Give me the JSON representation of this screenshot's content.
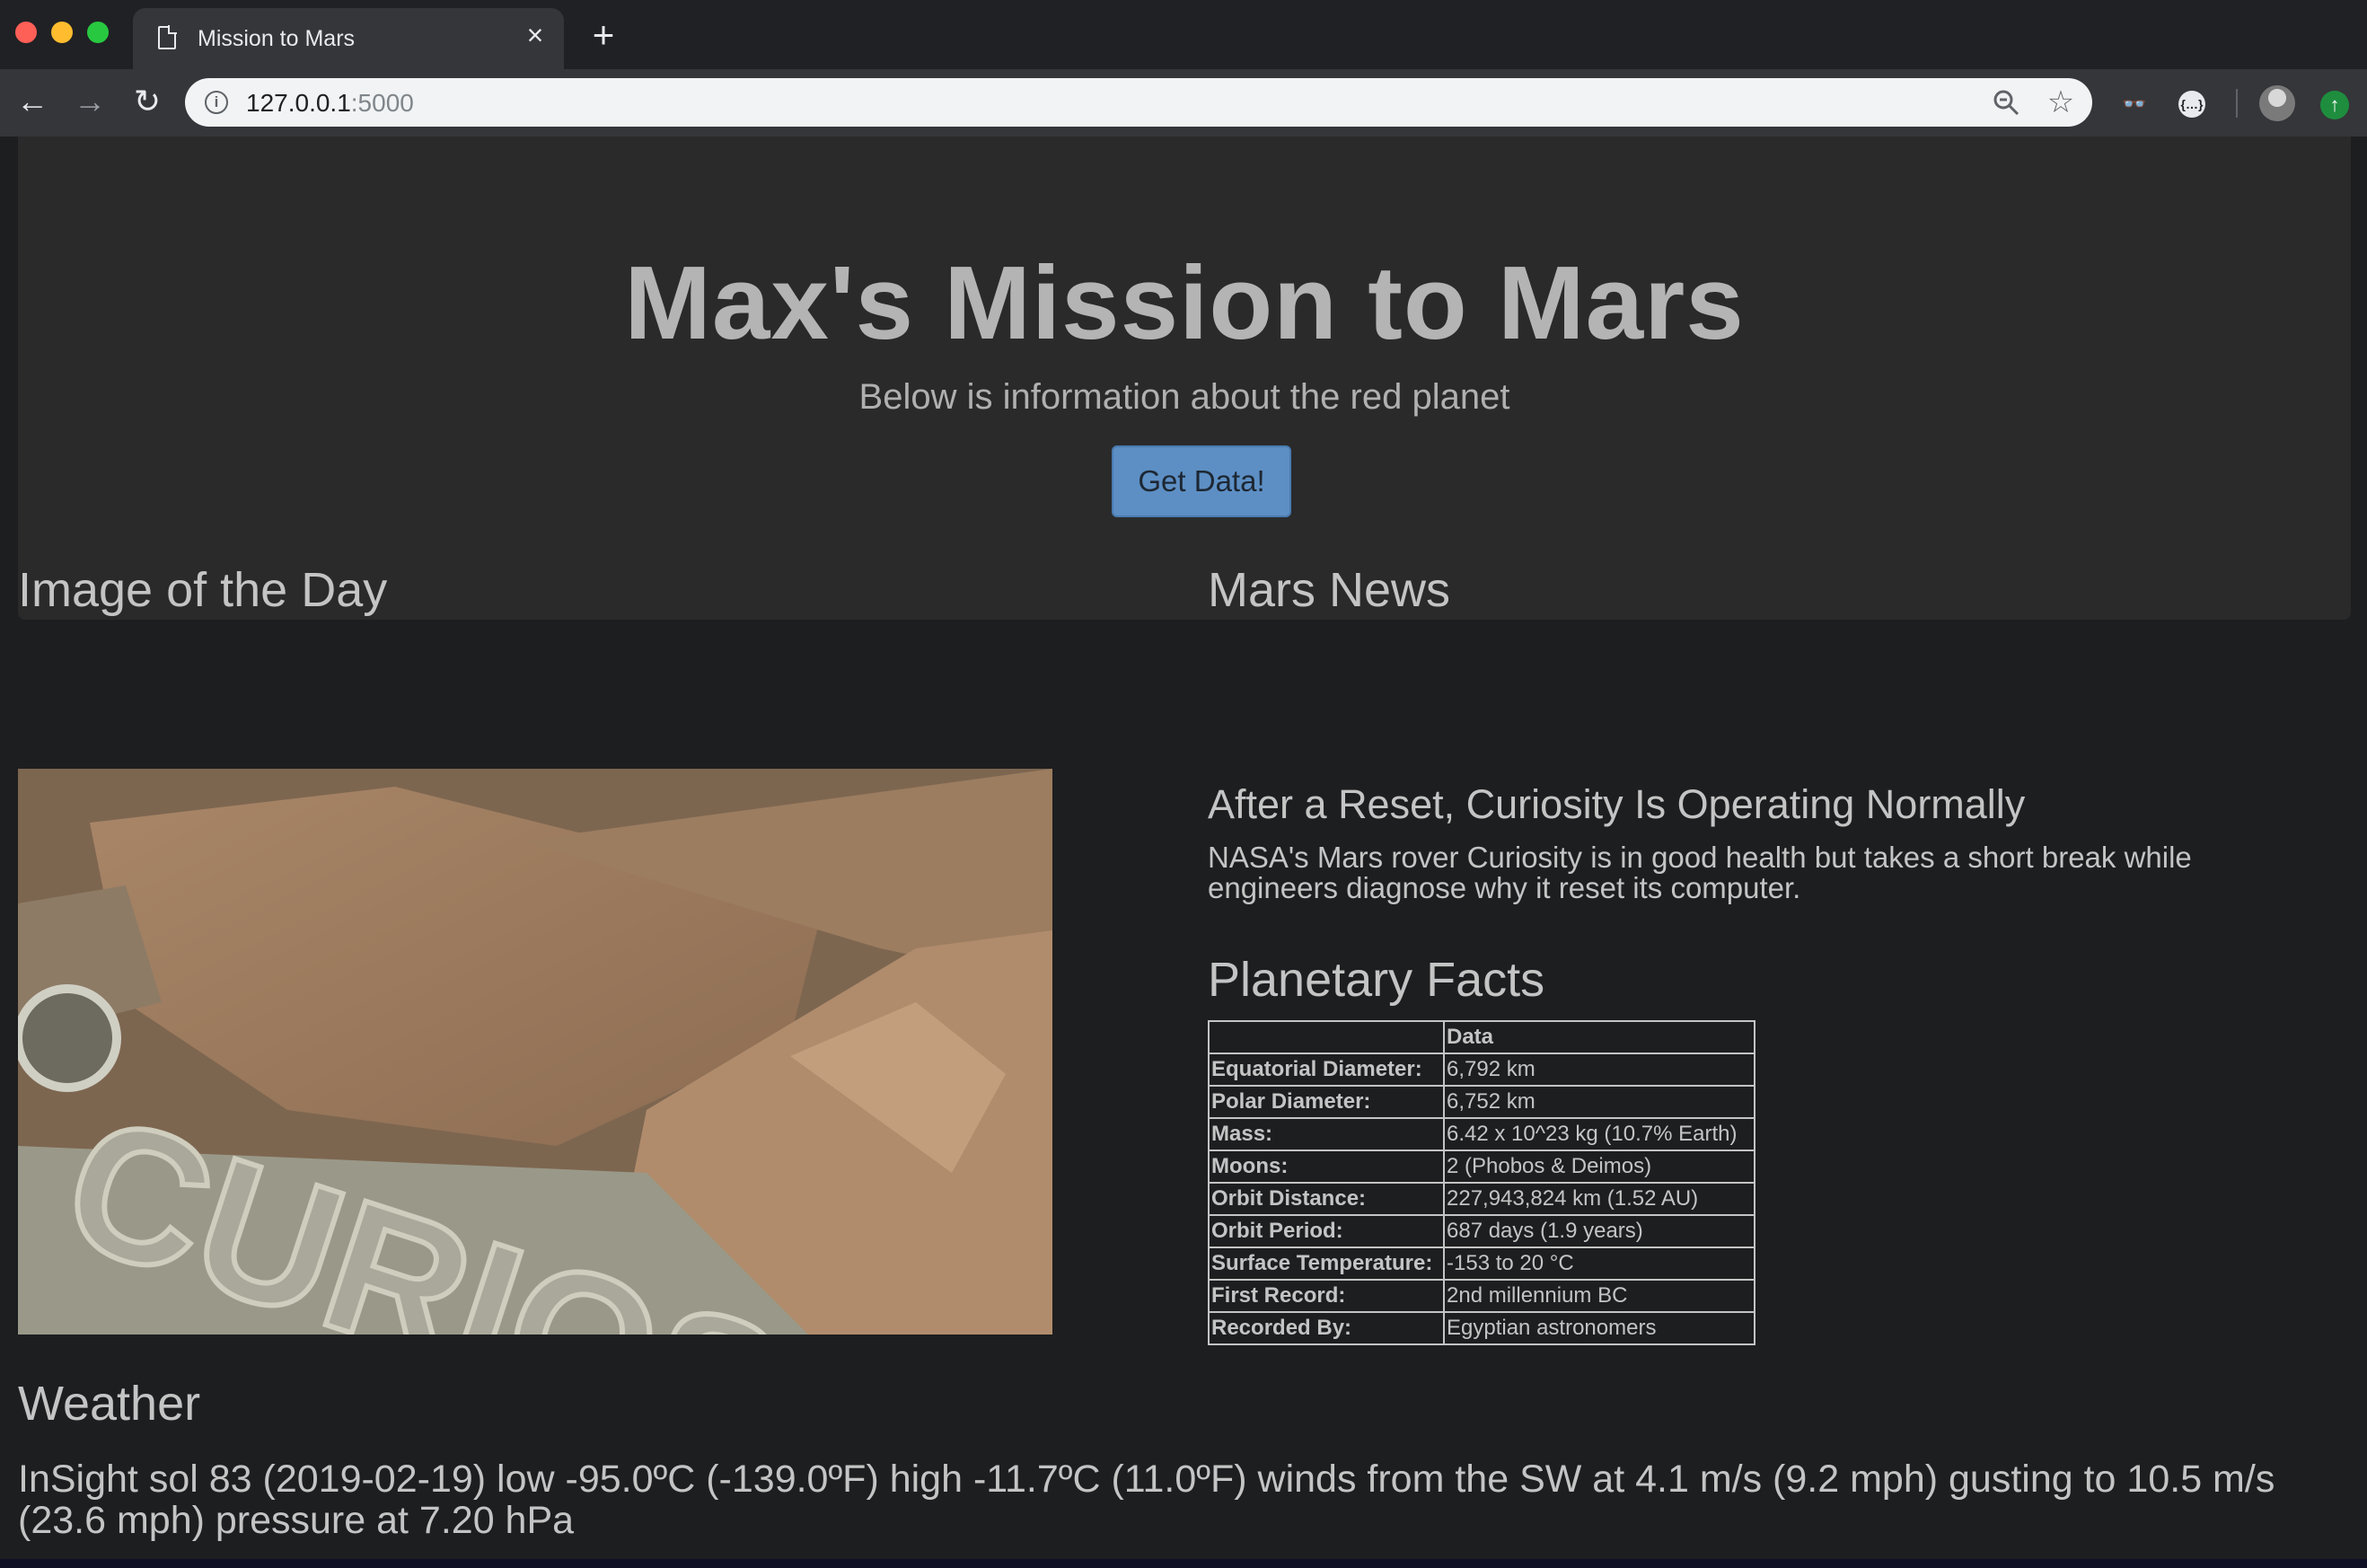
{
  "browser": {
    "tab_title": "Mission to Mars",
    "url_host": "127.0.0.1",
    "url_port": ":5000"
  },
  "jumbotron": {
    "title": "Max's Mission to Mars",
    "subtitle": "Below is information about the red planet",
    "button_label": "Get Data!"
  },
  "image_section": {
    "heading": "Image of the Day",
    "image_text": "CURIOS"
  },
  "news": {
    "heading": "Mars News",
    "title": "After a Reset, Curiosity Is Operating Normally",
    "body": "NASA's Mars rover Curiosity is in good health but takes a short break while engineers diagnose why it reset its computer."
  },
  "facts": {
    "heading": "Planetary Facts",
    "column_header": "Data",
    "rows": [
      {
        "label": "Equatorial Diameter:",
        "value": "6,792 km"
      },
      {
        "label": "Polar Diameter:",
        "value": "6,752 km"
      },
      {
        "label": "Mass:",
        "value": "6.42 x 10^23 kg (10.7% Earth)"
      },
      {
        "label": "Moons:",
        "value": "2 (Phobos & Deimos)"
      },
      {
        "label": "Orbit Distance:",
        "value": "227,943,824 km (1.52 AU)"
      },
      {
        "label": "Orbit Period:",
        "value": "687 days (1.9 years)"
      },
      {
        "label": "Surface Temperature:",
        "value": "-153 to 20 °C"
      },
      {
        "label": "First Record:",
        "value": "2nd millennium BC"
      },
      {
        "label": "Recorded By:",
        "value": "Egyptian astronomers"
      }
    ]
  },
  "weather": {
    "heading": "Weather",
    "text": "InSight sol 83 (2019-02-19) low -95.0ºC (-139.0ºF) high -11.7ºC (11.0ºF) winds from the SW at 4.1 m/s (9.2 mph) gusting to 10.5 m/s (23.6 mph) pressure at 7.20 hPa"
  },
  "colors": {
    "page_bg": "#1d1e20",
    "jumbotron_bg": "#2a2a2b",
    "button_bg": "#5d8fc4",
    "text": "#c4c4c4"
  }
}
